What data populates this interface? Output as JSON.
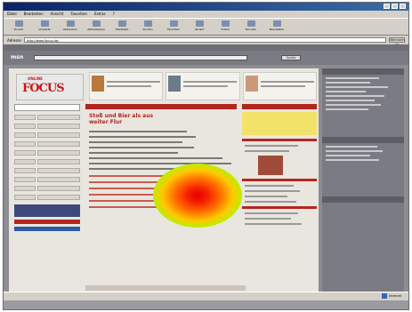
{
  "window": {
    "title": "",
    "menu": [
      "Datei",
      "Bearbeiten",
      "Ansicht",
      "Favoriten",
      "Extras",
      "?"
    ]
  },
  "toolbar": {
    "buttons": [
      {
        "label": "Zurück",
        "icon": "back-icon"
      },
      {
        "label": "Vorwärts",
        "icon": "forward-icon"
      },
      {
        "label": "Abbrechen",
        "icon": "stop-icon"
      },
      {
        "label": "Aktualisieren",
        "icon": "refresh-icon"
      },
      {
        "label": "Startseite",
        "icon": "home-icon"
      },
      {
        "label": "Suchen",
        "icon": "search-icon"
      },
      {
        "label": "Favoriten",
        "icon": "favorites-icon"
      },
      {
        "label": "Verlauf",
        "icon": "history-icon"
      },
      {
        "label": "E-Mail",
        "icon": "mail-icon"
      },
      {
        "label": "Drucken",
        "icon": "print-icon"
      },
      {
        "label": "Bearbeiten",
        "icon": "edit-icon"
      }
    ]
  },
  "address": {
    "label": "Adresse",
    "value": "http://www.focus.de/",
    "go_label": "Wechseln zu"
  },
  "site": {
    "portal_logo": "msn",
    "search_button": "Suche",
    "brand": "FOCUS",
    "brand_sub": "ONLINE",
    "section_head": "",
    "headline": "Stoß und Bier als aus weiter Flur",
    "right_head": "",
    "right_box": "",
    "bottom_title": ""
  },
  "statusbar": {
    "text": "",
    "zone": "Internet"
  },
  "colors": {
    "accent_red": "#b3261e",
    "title_blue": "#0a246a",
    "heatmap_center": "#d80000",
    "heatmap_edge": "#18c84a"
  }
}
